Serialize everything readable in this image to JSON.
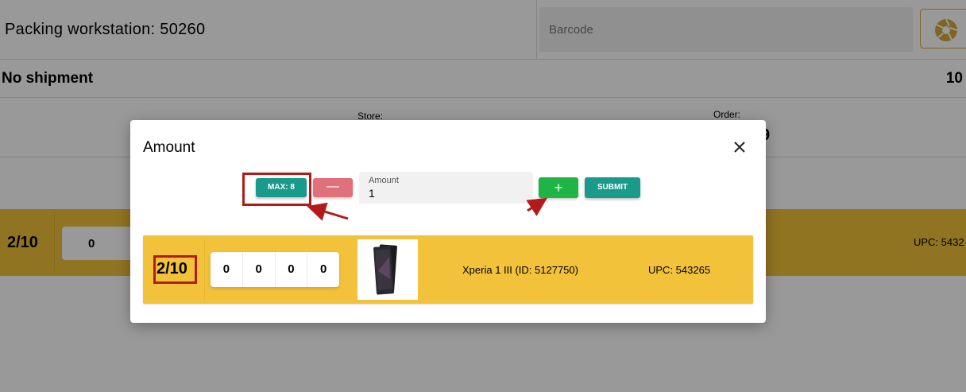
{
  "header": {
    "workstation_label": "Packing workstation: 50260",
    "barcode_placeholder": "Barcode"
  },
  "shipment": {
    "status": "No shipment",
    "count": "10"
  },
  "info": {
    "store_label": "Store:",
    "order_label": "Order:",
    "order_value": "9"
  },
  "background_item": {
    "count": "2/10",
    "digit": "0",
    "upc": "UPC: 5432"
  },
  "modal": {
    "title": "Amount",
    "max_label": "MAX: 8",
    "minus_label": "—",
    "amount_label": "Amount",
    "amount_value": "1",
    "plus_label": "+",
    "submit_label": "SUBMIT",
    "item": {
      "count": "2/10",
      "digits": [
        "0",
        "0",
        "0",
        "0"
      ],
      "name": "Xperia 1 III (ID: 5127750)",
      "upc": "UPC: 543265"
    }
  },
  "colors": {
    "teal": "#1a9a8a",
    "green": "#1fb544",
    "red": "#e0707a",
    "item_yellow": "#f2c23a",
    "annotation_red": "#b31b1b",
    "camera_gold": "#d7a83a"
  },
  "icons": {
    "camera": "camera-shutter-icon",
    "close": "close-icon",
    "phone": "phone-thumbnail"
  }
}
